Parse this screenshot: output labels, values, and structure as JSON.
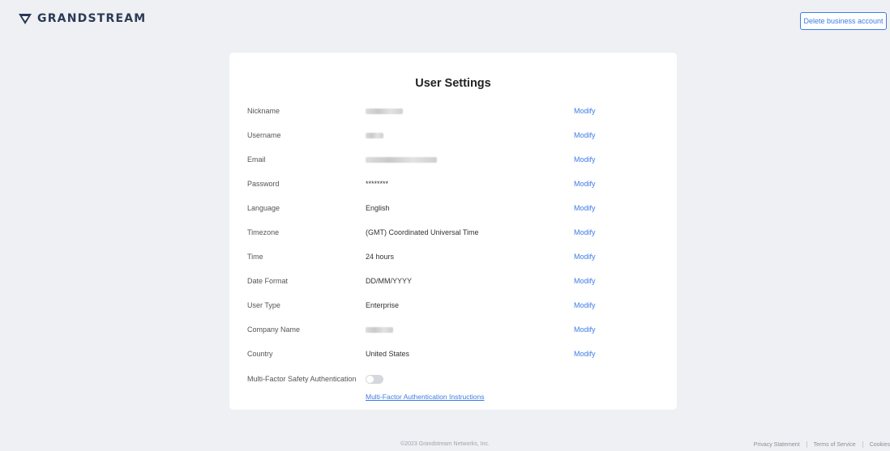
{
  "header": {
    "logo_text": "GRANDSTREAM",
    "logo_icon": "grandstream-logo-icon",
    "delete_account_label": "Delete business account"
  },
  "card": {
    "title": "User Settings",
    "modify_label": "Modify",
    "rows": [
      {
        "label": "Nickname",
        "value": "",
        "redacted": true,
        "action": "Modify"
      },
      {
        "label": "Username",
        "value": "",
        "redacted": true,
        "action": "Modify"
      },
      {
        "label": "Email",
        "value": "",
        "redacted": true,
        "action": "Modify"
      },
      {
        "label": "Password",
        "value": "********",
        "action": "Modify"
      },
      {
        "label": "Language",
        "value": "English",
        "action": "Modify"
      },
      {
        "label": "Timezone",
        "value": "(GMT) Coordinated Universal Time",
        "action": "Modify"
      },
      {
        "label": "Time",
        "value": "24 hours",
        "action": "Modify"
      },
      {
        "label": "Date Format",
        "value": "DD/MM/YYYY",
        "action": "Modify"
      },
      {
        "label": "User Type",
        "value": "Enterprise",
        "action": "Modify"
      },
      {
        "label": "Company Name",
        "value": "",
        "redacted": true,
        "action": "Modify"
      },
      {
        "label": "Country",
        "value": "United States",
        "action": "Modify"
      }
    ],
    "mfa": {
      "label": "Multi-Factor Safety Authentication",
      "enabled": false,
      "instructions_link": "Multi-Factor Authentication Instructions"
    }
  },
  "footer": {
    "copyright": "©2023 Grandstream Networks, Inc.",
    "links": [
      "Privacy Statement",
      "Terms of Service",
      "Cookies"
    ]
  },
  "colors": {
    "accent": "#3d7be6",
    "background": "#eef0f3",
    "card": "#ffffff"
  }
}
